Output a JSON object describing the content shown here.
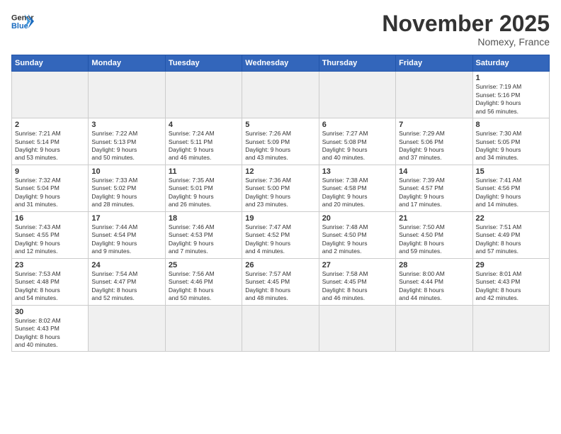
{
  "header": {
    "logo_general": "General",
    "logo_blue": "Blue",
    "month": "November 2025",
    "location": "Nomexy, France"
  },
  "days_of_week": [
    "Sunday",
    "Monday",
    "Tuesday",
    "Wednesday",
    "Thursday",
    "Friday",
    "Saturday"
  ],
  "weeks": [
    [
      {
        "day": "",
        "info": ""
      },
      {
        "day": "",
        "info": ""
      },
      {
        "day": "",
        "info": ""
      },
      {
        "day": "",
        "info": ""
      },
      {
        "day": "",
        "info": ""
      },
      {
        "day": "",
        "info": ""
      },
      {
        "day": "1",
        "info": "Sunrise: 7:19 AM\nSunset: 5:16 PM\nDaylight: 9 hours\nand 56 minutes."
      }
    ],
    [
      {
        "day": "2",
        "info": "Sunrise: 7:21 AM\nSunset: 5:14 PM\nDaylight: 9 hours\nand 53 minutes."
      },
      {
        "day": "3",
        "info": "Sunrise: 7:22 AM\nSunset: 5:13 PM\nDaylight: 9 hours\nand 50 minutes."
      },
      {
        "day": "4",
        "info": "Sunrise: 7:24 AM\nSunset: 5:11 PM\nDaylight: 9 hours\nand 46 minutes."
      },
      {
        "day": "5",
        "info": "Sunrise: 7:26 AM\nSunset: 5:09 PM\nDaylight: 9 hours\nand 43 minutes."
      },
      {
        "day": "6",
        "info": "Sunrise: 7:27 AM\nSunset: 5:08 PM\nDaylight: 9 hours\nand 40 minutes."
      },
      {
        "day": "7",
        "info": "Sunrise: 7:29 AM\nSunset: 5:06 PM\nDaylight: 9 hours\nand 37 minutes."
      },
      {
        "day": "8",
        "info": "Sunrise: 7:30 AM\nSunset: 5:05 PM\nDaylight: 9 hours\nand 34 minutes."
      }
    ],
    [
      {
        "day": "9",
        "info": "Sunrise: 7:32 AM\nSunset: 5:04 PM\nDaylight: 9 hours\nand 31 minutes."
      },
      {
        "day": "10",
        "info": "Sunrise: 7:33 AM\nSunset: 5:02 PM\nDaylight: 9 hours\nand 28 minutes."
      },
      {
        "day": "11",
        "info": "Sunrise: 7:35 AM\nSunset: 5:01 PM\nDaylight: 9 hours\nand 26 minutes."
      },
      {
        "day": "12",
        "info": "Sunrise: 7:36 AM\nSunset: 5:00 PM\nDaylight: 9 hours\nand 23 minutes."
      },
      {
        "day": "13",
        "info": "Sunrise: 7:38 AM\nSunset: 4:58 PM\nDaylight: 9 hours\nand 20 minutes."
      },
      {
        "day": "14",
        "info": "Sunrise: 7:39 AM\nSunset: 4:57 PM\nDaylight: 9 hours\nand 17 minutes."
      },
      {
        "day": "15",
        "info": "Sunrise: 7:41 AM\nSunset: 4:56 PM\nDaylight: 9 hours\nand 14 minutes."
      }
    ],
    [
      {
        "day": "16",
        "info": "Sunrise: 7:43 AM\nSunset: 4:55 PM\nDaylight: 9 hours\nand 12 minutes."
      },
      {
        "day": "17",
        "info": "Sunrise: 7:44 AM\nSunset: 4:54 PM\nDaylight: 9 hours\nand 9 minutes."
      },
      {
        "day": "18",
        "info": "Sunrise: 7:46 AM\nSunset: 4:53 PM\nDaylight: 9 hours\nand 7 minutes."
      },
      {
        "day": "19",
        "info": "Sunrise: 7:47 AM\nSunset: 4:52 PM\nDaylight: 9 hours\nand 4 minutes."
      },
      {
        "day": "20",
        "info": "Sunrise: 7:48 AM\nSunset: 4:50 PM\nDaylight: 9 hours\nand 2 minutes."
      },
      {
        "day": "21",
        "info": "Sunrise: 7:50 AM\nSunset: 4:50 PM\nDaylight: 8 hours\nand 59 minutes."
      },
      {
        "day": "22",
        "info": "Sunrise: 7:51 AM\nSunset: 4:49 PM\nDaylight: 8 hours\nand 57 minutes."
      }
    ],
    [
      {
        "day": "23",
        "info": "Sunrise: 7:53 AM\nSunset: 4:48 PM\nDaylight: 8 hours\nand 54 minutes."
      },
      {
        "day": "24",
        "info": "Sunrise: 7:54 AM\nSunset: 4:47 PM\nDaylight: 8 hours\nand 52 minutes."
      },
      {
        "day": "25",
        "info": "Sunrise: 7:56 AM\nSunset: 4:46 PM\nDaylight: 8 hours\nand 50 minutes."
      },
      {
        "day": "26",
        "info": "Sunrise: 7:57 AM\nSunset: 4:45 PM\nDaylight: 8 hours\nand 48 minutes."
      },
      {
        "day": "27",
        "info": "Sunrise: 7:58 AM\nSunset: 4:45 PM\nDaylight: 8 hours\nand 46 minutes."
      },
      {
        "day": "28",
        "info": "Sunrise: 8:00 AM\nSunset: 4:44 PM\nDaylight: 8 hours\nand 44 minutes."
      },
      {
        "day": "29",
        "info": "Sunrise: 8:01 AM\nSunset: 4:43 PM\nDaylight: 8 hours\nand 42 minutes."
      }
    ],
    [
      {
        "day": "30",
        "info": "Sunrise: 8:02 AM\nSunset: 4:43 PM\nDaylight: 8 hours\nand 40 minutes."
      },
      {
        "day": "",
        "info": ""
      },
      {
        "day": "",
        "info": ""
      },
      {
        "day": "",
        "info": ""
      },
      {
        "day": "",
        "info": ""
      },
      {
        "day": "",
        "info": ""
      },
      {
        "day": "",
        "info": ""
      }
    ]
  ]
}
